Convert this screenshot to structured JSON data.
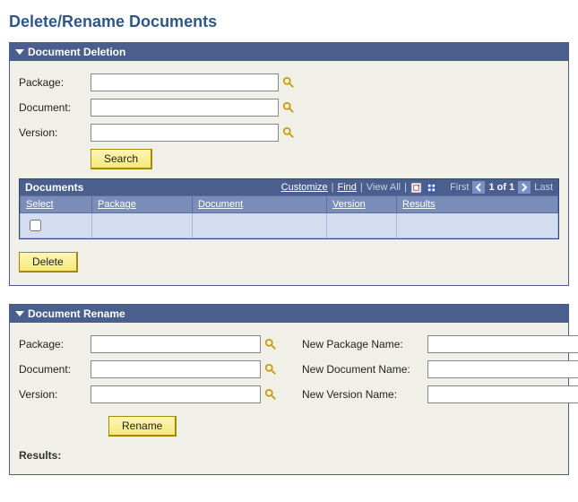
{
  "page": {
    "title": "Delete/Rename Documents"
  },
  "deletion": {
    "header": "Document Deletion",
    "labels": {
      "package": "Package:",
      "document": "Document:",
      "version": "Version:"
    },
    "fields": {
      "package": "",
      "document": "",
      "version": ""
    },
    "search_label": "Search",
    "delete_label": "Delete",
    "grid": {
      "title": "Documents",
      "tools": {
        "customize": "Customize",
        "find": "Find",
        "view_all": "View All",
        "first": "First",
        "range": "1 of 1",
        "last": "Last"
      },
      "columns": {
        "select": "Select",
        "package": "Package",
        "document": "Document",
        "version": "Version",
        "results": "Results"
      },
      "rows": [
        {
          "selected": false,
          "package": "",
          "document": "",
          "version": "",
          "results": ""
        }
      ]
    }
  },
  "rename": {
    "header": "Document Rename",
    "labels": {
      "package": "Package:",
      "document": "Document:",
      "version": "Version:",
      "new_package": "New Package Name:",
      "new_document": "New Document Name:",
      "new_version": "New Version Name:"
    },
    "fields": {
      "package": "",
      "document": "",
      "version": "",
      "new_package": "",
      "new_document": "",
      "new_version": ""
    },
    "rename_label": "Rename",
    "results_label": "Results:"
  }
}
